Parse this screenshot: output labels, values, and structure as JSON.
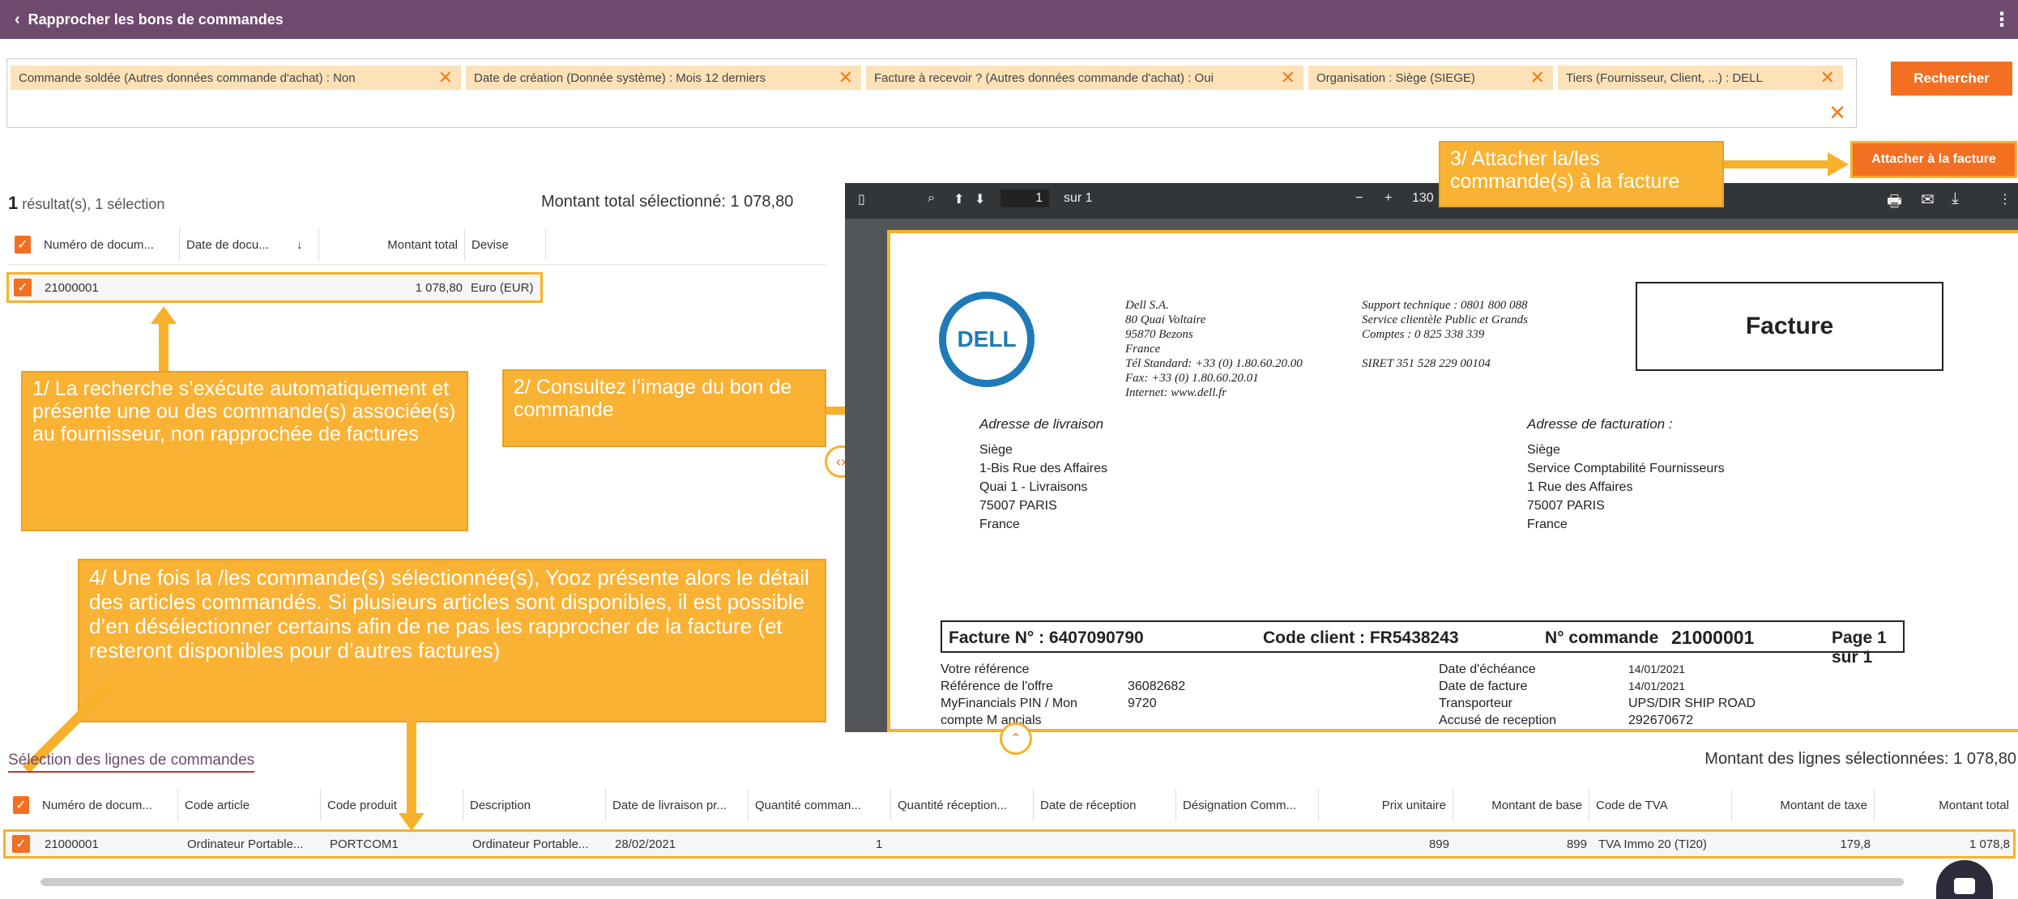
{
  "header": {
    "back_icon": "chevron-left-icon",
    "title": "Rapprocher les bons de commandes",
    "menu_icon": "kebab-icon"
  },
  "filters": [
    "Commande soldée (Autres données commande d'achat) : Non",
    "Date de création (Donnée système) : Mois 12 derniers",
    "Facture à recevoir ? (Autres données commande d'achat) : Oui",
    "Organisation : Siège (SIEGE)",
    "Tiers (Fournisseur, Client, ...) : DELL"
  ],
  "filter_remove_glyph": "✕",
  "buttons": {
    "search": "Rechercher",
    "attach": "Attacher à la facture"
  },
  "results": {
    "count": "1",
    "count_suffix": "résultat(s), 1 sélection",
    "total_selected": "Montant total sélectionné: 1 078,80",
    "headers": [
      "Numéro de docum...",
      "Date de docu...",
      "↓",
      "Montant total",
      "Devise"
    ],
    "row": {
      "numero": "21000001",
      "date": "",
      "montant": "1 078,80",
      "devise": "Euro (EUR)"
    }
  },
  "pdf": {
    "page_value": "1",
    "page_of": "sur 1",
    "zoom": "130",
    "supplier": [
      "Dell S.A.",
      "80 Quai Voltaire",
      "95870 Bezons",
      "France",
      "Tél Standard: +33 (0) 1.80.60.20.00",
      "Fax: +33 (0) 1.80.60.20.01",
      "Internet: www.dell.fr"
    ],
    "support": [
      "Support technique : 0801 800 088",
      "Service clientèle Public et Grands",
      "Comptes : 0 825 338 339",
      "",
      "SIRET 351 528 229 00104"
    ],
    "doc_title": "Facture",
    "logo_text": "DELL",
    "delivery_title": "Adresse de livraison",
    "delivery": [
      "Siège",
      "1-Bis Rue des Affaires",
      "Quai 1 - Livraisons",
      "75007 PARIS",
      "France"
    ],
    "billing_title": "Adresse de facturation :",
    "billing": [
      "Siège",
      "Service Comptabilité Fournisseurs",
      "1 Rue des Affaires",
      "75007 PARIS",
      "France"
    ],
    "invoice_no": "Facture N° : 6407090790",
    "client_code": "Code client : FR5438243",
    "order_label": "N° commande",
    "order_no": "21000001",
    "page_label": "Page",
    "page_no": "1 sur 1",
    "refs_left": [
      "Votre référence",
      "Référence de l'offre",
      "MyFinancials PIN / Mon",
      "compte M    ancials"
    ],
    "refs_left_vals": [
      "",
      "36082682",
      "9720",
      ""
    ],
    "refs_right": [
      "Date d'échéance",
      "Date de facture",
      "Transporteur",
      "Accusé de reception"
    ],
    "refs_right_vals": [
      "14/01/2021",
      "14/01/2021",
      "UPS/DIR SHIP ROAD",
      "292670672"
    ]
  },
  "callouts": {
    "c1": "1/ La recherche s’exécute automatiquement et présente une ou des commande(s) associée(s) au fournisseur, non rapprochée de factures",
    "c2": "2/ Consultez l’image du bon de commande",
    "c3": "3/ Attacher la/les commande(s) à la facture",
    "c4": "4/ Une fois la /les commande(s) sélectionnée(s), Yooz présente alors le détail des articles commandés. Si plusieurs articles sont disponibles, il est possible d’en désélectionner certains afin de ne pas les rapprocher de la facture (et resteront disponibles pour d’autres factures)"
  },
  "lines": {
    "title": "Sélection des lignes de commandes",
    "total": "Montant des lignes sélectionnées: 1 078,80",
    "headers": [
      "Numéro de docum...",
      "Code article",
      "Code produit",
      "Description",
      "Date de livraison pr...",
      "Quantité comman...",
      "Quantité réception...",
      "Date de réception",
      "Désignation Comm...",
      "Prix unitaire",
      "Montant de base",
      "Code de TVA",
      "Montant de taxe",
      "Montant total"
    ],
    "row": [
      "21000001",
      "Ordinateur Portable...",
      "PORTCOM1",
      "Ordinateur Portable...",
      "28/02/2021",
      "1",
      "",
      "",
      "",
      "899",
      "899",
      "TVA Immo 20 (TI20)",
      "179,8",
      "1 078,8"
    ]
  },
  "colors": {
    "header": "#6e4a6e",
    "accent": "#f36f21",
    "callout": "#f9b233",
    "chip": "#fde1b8"
  }
}
